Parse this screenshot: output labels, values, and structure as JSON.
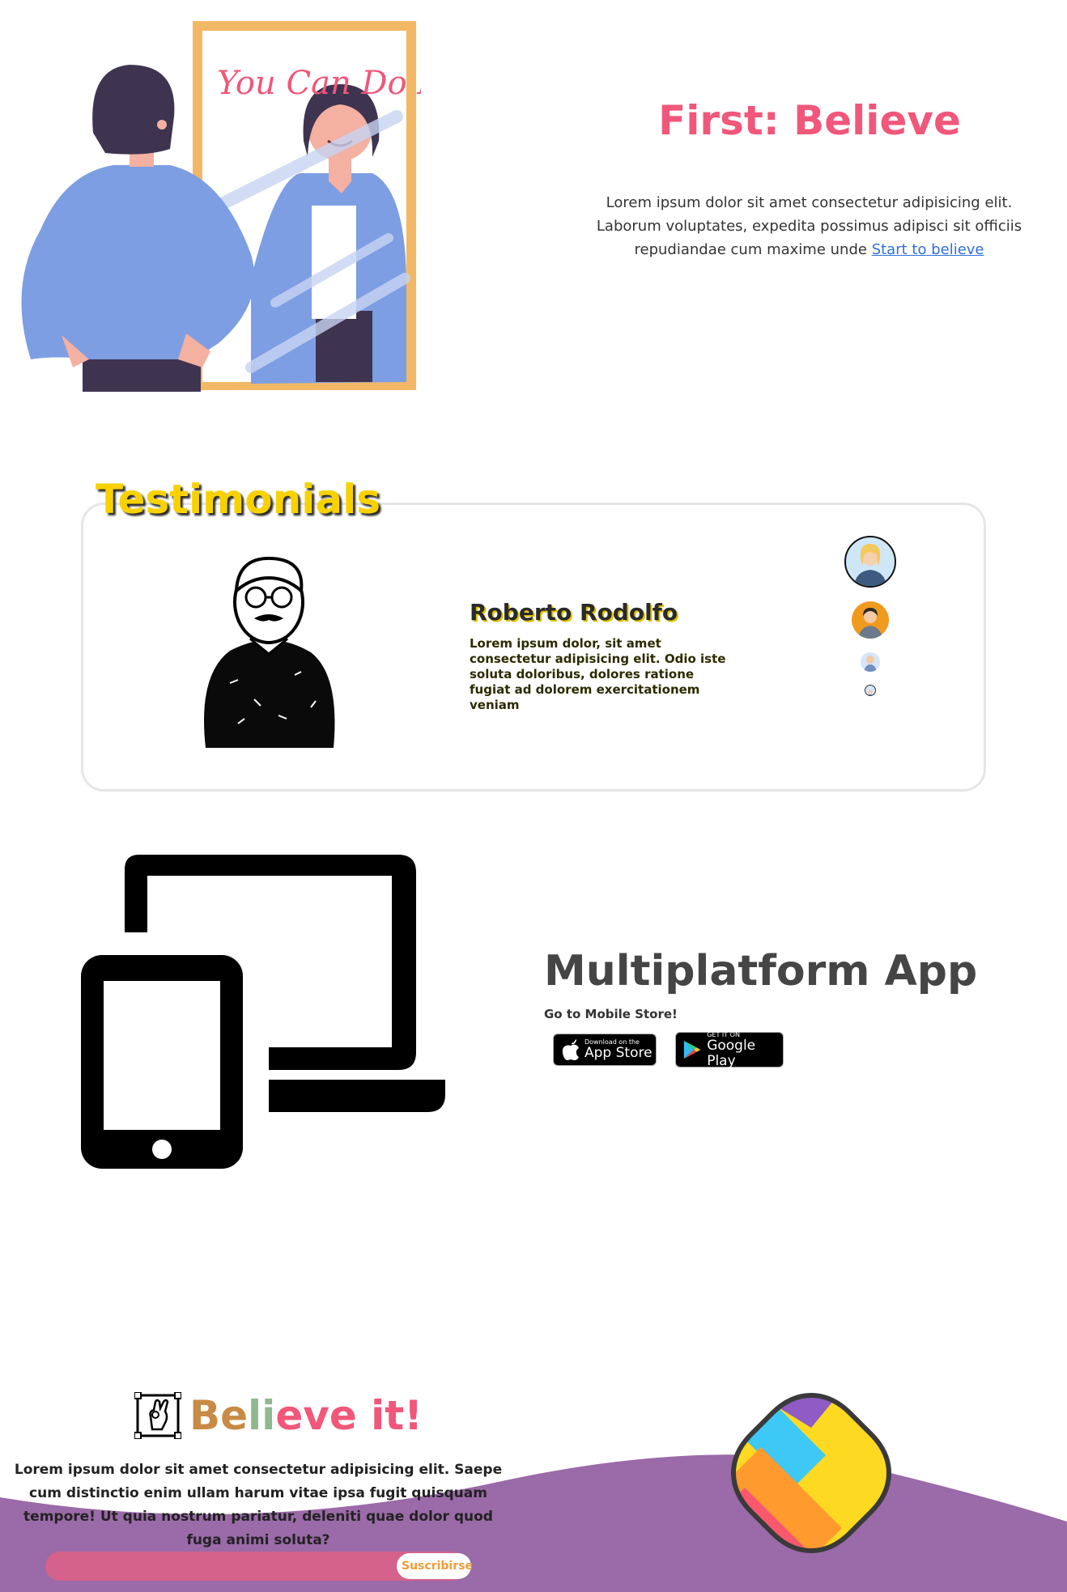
{
  "hero": {
    "illustration_text": "You Can Do It!",
    "title": "First: Believe",
    "text": "Lorem ipsum dolor sit amet consectetur adipisicing elit. Laborum voluptates, expedita possimus adipisci sit officiis repudiandae cum maxime unde",
    "link": "Start to believe"
  },
  "testimonials": {
    "title": "Testimonials",
    "name": "Roberto Rodolfo",
    "text": "Lorem ipsum dolor, sit amet consectetur adipisicing elit. Odio iste soluta doloribus, dolores ratione fugiat ad dolorem exercitationem veniam",
    "avatars": [
      "woman-avatar",
      "man-avatar",
      "person-avatar-small",
      "person-avatar-tiny"
    ]
  },
  "multiplatform": {
    "title": "Multiplatform App",
    "subtitle": "Go to Mobile Store!",
    "appstore": {
      "small": "Download on the",
      "big": "App Store"
    },
    "googleplay": {
      "small": "GET IT ON",
      "big": "Google Play"
    }
  },
  "footer": {
    "title_parts": [
      "Be",
      "li",
      "eve",
      " it!"
    ],
    "title_colors": [
      "#c98a45",
      "#8fb88f",
      "#f0577a",
      "#f0577a"
    ],
    "text": "Lorem ipsum dolor sit amet consectetur adipisicing elit. Saepe cum distinctio enim ullam harum vitae ipsa fugit quisquam tempore! Ut quia nostrum pariatur, deleniti quae dolor quod fuga animi soluta?",
    "subscribe_label": "Suscribirse",
    "wave_color": "#9b6aa8"
  },
  "colors": {
    "accent_pink": "#f0577a",
    "accent_yellow": "#f7d200",
    "link_blue": "#2f6fd6"
  }
}
